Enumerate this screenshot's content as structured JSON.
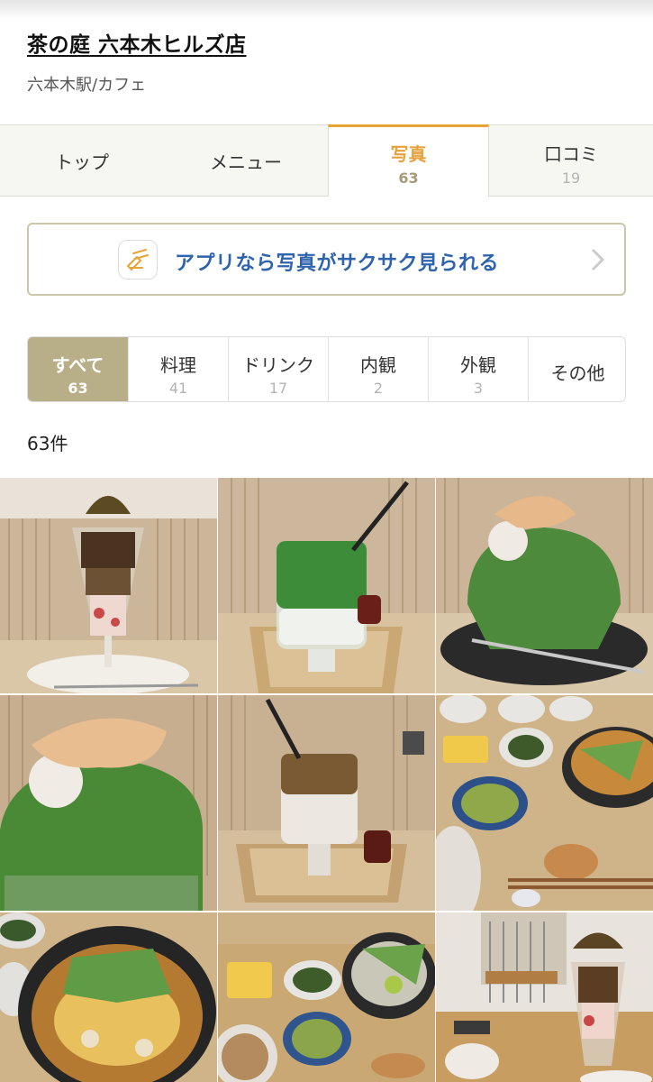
{
  "shop": {
    "title": "茶の庭 六本木ヒルズ店",
    "subtitle": "六本木駅/カフェ"
  },
  "tabs": [
    {
      "label": "トップ",
      "count": ""
    },
    {
      "label": "メニュー",
      "count": ""
    },
    {
      "label": "写真",
      "count": "63"
    },
    {
      "label": "口コミ",
      "count": "19"
    }
  ],
  "app_banner": {
    "text": "アプリなら写真がサクサク見られる",
    "icon": "app-icon",
    "arrow_icon": "chevron-right-icon"
  },
  "filters": [
    {
      "label": "すべて",
      "count": "63"
    },
    {
      "label": "料理",
      "count": "41"
    },
    {
      "label": "ドリンク",
      "count": "17"
    },
    {
      "label": "内観",
      "count": "2"
    },
    {
      "label": "外観",
      "count": "3"
    },
    {
      "label": "その他",
      "count": ""
    }
  ],
  "result_count": "63件",
  "colors": {
    "accent": "#e8a335",
    "selected_filter": "#b8ae88",
    "link_blue": "#2e63ad",
    "banner_border": "#ccc6a8"
  }
}
